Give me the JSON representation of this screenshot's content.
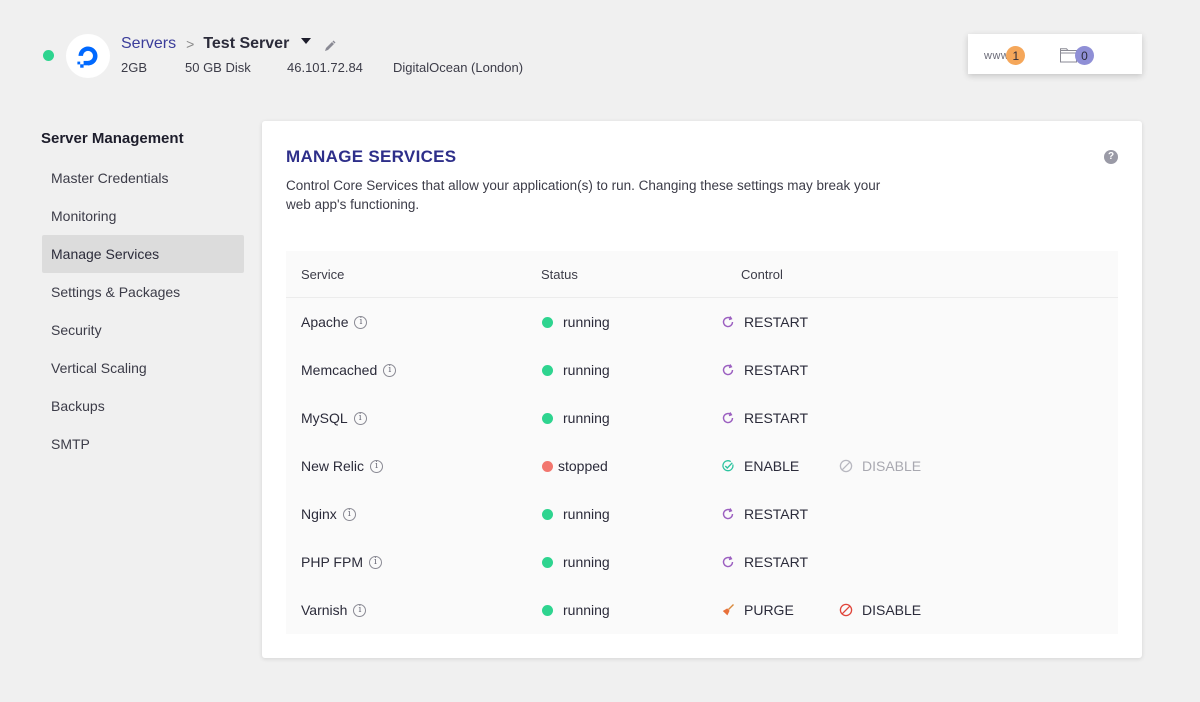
{
  "header": {
    "breadcrumb_root": "Servers",
    "server_name": "Test Server",
    "meta": {
      "ram": "2GB",
      "disk": "50 GB Disk",
      "ip": "46.101.72.84",
      "provider": "DigitalOcean (London)"
    },
    "apps": {
      "label": "www",
      "count": "1"
    },
    "folders": {
      "count": "0"
    }
  },
  "sidebar": {
    "title": "Server Management",
    "items": [
      {
        "label": "Master Credentials"
      },
      {
        "label": "Monitoring"
      },
      {
        "label": "Manage Services",
        "active": true
      },
      {
        "label": "Settings & Packages"
      },
      {
        "label": "Security"
      },
      {
        "label": "Vertical Scaling"
      },
      {
        "label": "Backups"
      },
      {
        "label": "SMTP"
      }
    ]
  },
  "main": {
    "title": "MANAGE SERVICES",
    "description": "Control Core Services that allow your application(s) to run. Changing these settings may break your web app's functioning.",
    "help": "?",
    "table": {
      "headers": {
        "service": "Service",
        "status": "Status",
        "control": "Control"
      },
      "rows": [
        {
          "name": "Apache",
          "status": "running",
          "action1": "RESTART"
        },
        {
          "name": "Memcached",
          "status": "running",
          "action1": "RESTART"
        },
        {
          "name": "MySQL",
          "status": "running",
          "action1": "RESTART"
        },
        {
          "name": "New Relic",
          "status": "stopped",
          "action1": "ENABLE",
          "action2": "DISABLE"
        },
        {
          "name": "Nginx",
          "status": "running",
          "action1": "RESTART"
        },
        {
          "name": "PHP FPM",
          "status": "running",
          "action1": "RESTART"
        },
        {
          "name": "Varnish",
          "status": "running",
          "action1": "PURGE",
          "action2": "DISABLE"
        }
      ]
    }
  },
  "colors": {
    "accent": "#2e2f8a",
    "running": "#2ed48f",
    "stopped": "#f2766e",
    "restart_icon": "#9b5fc0",
    "enable_icon": "#2ec4a0",
    "disable_icon": "#e0443a"
  },
  "icons": {
    "logo": "digitalocean-logo",
    "restart": "restart-icon",
    "enable": "check-circle-icon",
    "disable": "ban-icon",
    "purge": "broom-icon"
  }
}
